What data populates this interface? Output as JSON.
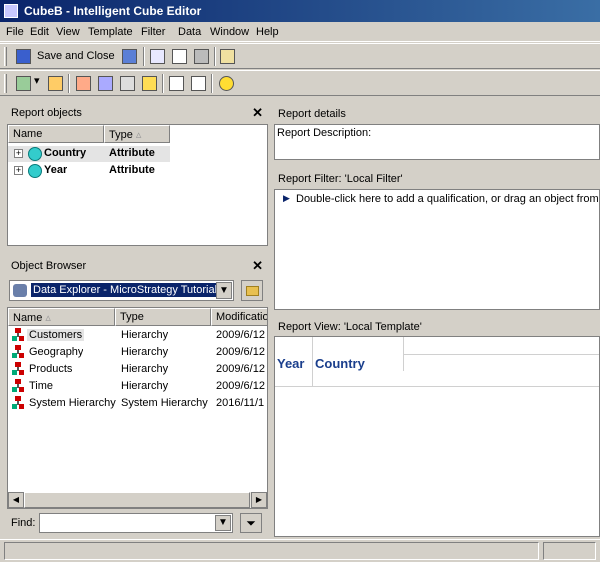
{
  "window": {
    "title": "CubeB - Intelligent Cube Editor"
  },
  "menu": {
    "items": [
      "File",
      "Edit",
      "View",
      "Template",
      "Filter",
      "Data",
      "Window",
      "Help"
    ]
  },
  "toolbar": {
    "save_close_label": "Save and Close"
  },
  "report_objects": {
    "title": "Report objects",
    "columns": [
      "Name",
      "Type"
    ],
    "rows": [
      {
        "name": "Country",
        "type": "Attribute"
      },
      {
        "name": "Year",
        "type": "Attribute"
      }
    ]
  },
  "object_browser": {
    "title": "Object Browser",
    "source": "Data Explorer - MicroStrategy Tutorial",
    "columns": [
      "Name",
      "Type",
      "Modification"
    ],
    "rows": [
      {
        "name": "Customers",
        "type": "Hierarchy",
        "modified": "2009/6/12"
      },
      {
        "name": "Geography",
        "type": "Hierarchy",
        "modified": "2009/6/12"
      },
      {
        "name": "Products",
        "type": "Hierarchy",
        "modified": "2009/6/12"
      },
      {
        "name": "Time",
        "type": "Hierarchy",
        "modified": "2009/6/12"
      },
      {
        "name": "System Hierarchy",
        "type": "System Hierarchy",
        "modified": "2016/11/1"
      }
    ],
    "find_label": "Find:",
    "find_value": ""
  },
  "report_details": {
    "title": "Report details",
    "description_label": "Report Description:"
  },
  "report_filter": {
    "title": "Report Filter: 'Local Filter'",
    "hint": "Double-click here to add a qualification, or drag an object from t"
  },
  "report_view": {
    "title": "Report View: 'Local Template'",
    "row_headers": [
      "Year",
      "Country"
    ]
  }
}
